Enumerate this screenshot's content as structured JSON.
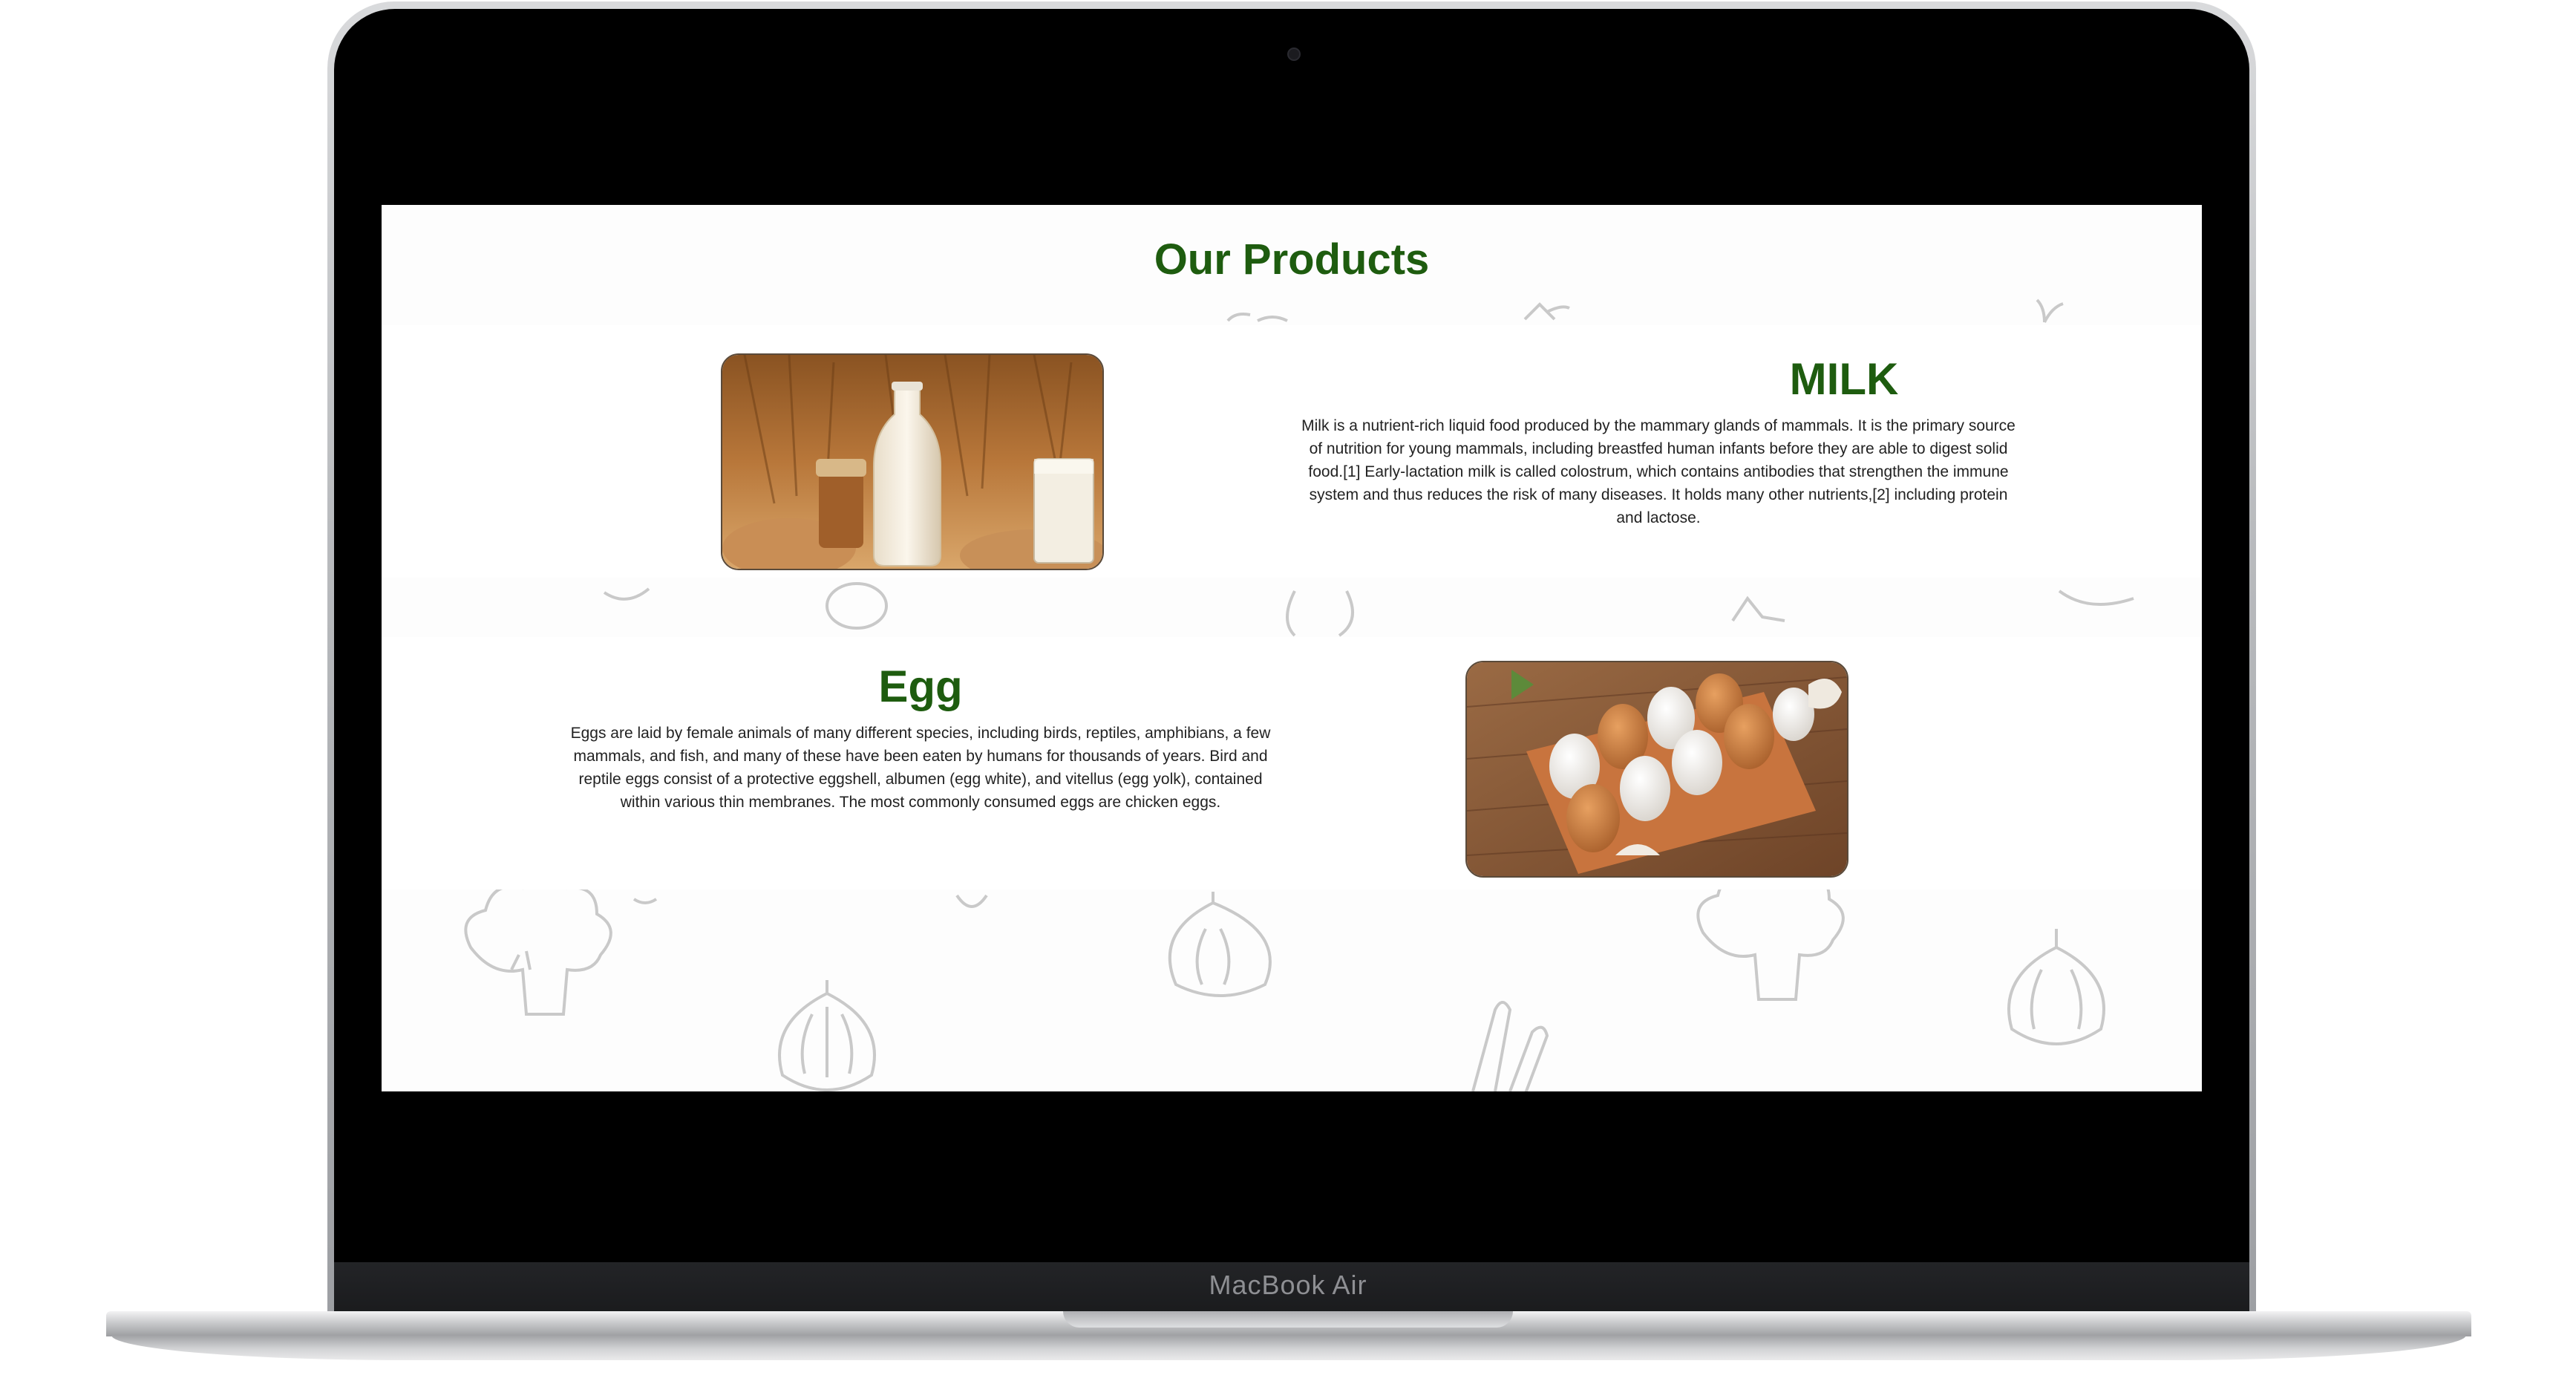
{
  "device": {
    "brand_label": "MacBook Air"
  },
  "page": {
    "section_title": "Our Products",
    "products": [
      {
        "title": "MILK",
        "image_alt": "Glass bottle of milk with a glass of milk and bread in a wheat field",
        "description": "Milk is a nutrient-rich liquid food produced by the mammary glands of mammals. It is the primary source of nutrition for young mammals, including breastfed human infants before they are able to digest solid food.[1] Early-lactation milk is called colostrum, which contains antibodies that strengthen the immune system and thus reduces the risk of many diseases. It holds many other nutrients,[2] including protein and lactose."
      },
      {
        "title": "Egg",
        "image_alt": "Brown and white chicken eggs in an egg carton on a wooden table",
        "description": "Eggs are laid by female animals of many different species, including birds, reptiles, amphibians, a few mammals, and fish, and many of these have been eaten by humans for thousands of years. Bird and reptile eggs consist of a protective eggshell, albumen (egg white), and vitellus (egg yolk), contained within various thin membranes. The most commonly consumed eggs are chicken eggs."
      }
    ]
  },
  "colors": {
    "heading_green": "#1e5c0f",
    "body_text": "#222222",
    "doodle_gray": "#c9c9c9"
  }
}
